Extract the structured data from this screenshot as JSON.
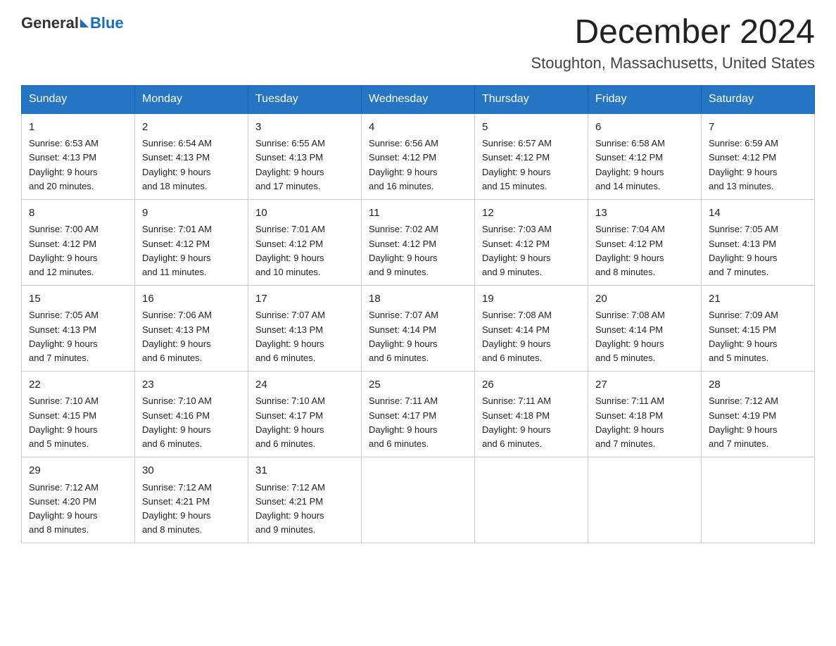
{
  "header": {
    "logo_general": "General",
    "logo_blue": "Blue",
    "month_title": "December 2024",
    "location": "Stoughton, Massachusetts, United States"
  },
  "days_header": [
    "Sunday",
    "Monday",
    "Tuesday",
    "Wednesday",
    "Thursday",
    "Friday",
    "Saturday"
  ],
  "weeks": [
    [
      {
        "day": "1",
        "sunrise": "6:53 AM",
        "sunset": "4:13 PM",
        "daylight": "9 hours and 20 minutes."
      },
      {
        "day": "2",
        "sunrise": "6:54 AM",
        "sunset": "4:13 PM",
        "daylight": "9 hours and 18 minutes."
      },
      {
        "day": "3",
        "sunrise": "6:55 AM",
        "sunset": "4:13 PM",
        "daylight": "9 hours and 17 minutes."
      },
      {
        "day": "4",
        "sunrise": "6:56 AM",
        "sunset": "4:12 PM",
        "daylight": "9 hours and 16 minutes."
      },
      {
        "day": "5",
        "sunrise": "6:57 AM",
        "sunset": "4:12 PM",
        "daylight": "9 hours and 15 minutes."
      },
      {
        "day": "6",
        "sunrise": "6:58 AM",
        "sunset": "4:12 PM",
        "daylight": "9 hours and 14 minutes."
      },
      {
        "day": "7",
        "sunrise": "6:59 AM",
        "sunset": "4:12 PM",
        "daylight": "9 hours and 13 minutes."
      }
    ],
    [
      {
        "day": "8",
        "sunrise": "7:00 AM",
        "sunset": "4:12 PM",
        "daylight": "9 hours and 12 minutes."
      },
      {
        "day": "9",
        "sunrise": "7:01 AM",
        "sunset": "4:12 PM",
        "daylight": "9 hours and 11 minutes."
      },
      {
        "day": "10",
        "sunrise": "7:01 AM",
        "sunset": "4:12 PM",
        "daylight": "9 hours and 10 minutes."
      },
      {
        "day": "11",
        "sunrise": "7:02 AM",
        "sunset": "4:12 PM",
        "daylight": "9 hours and 9 minutes."
      },
      {
        "day": "12",
        "sunrise": "7:03 AM",
        "sunset": "4:12 PM",
        "daylight": "9 hours and 9 minutes."
      },
      {
        "day": "13",
        "sunrise": "7:04 AM",
        "sunset": "4:12 PM",
        "daylight": "9 hours and 8 minutes."
      },
      {
        "day": "14",
        "sunrise": "7:05 AM",
        "sunset": "4:13 PM",
        "daylight": "9 hours and 7 minutes."
      }
    ],
    [
      {
        "day": "15",
        "sunrise": "7:05 AM",
        "sunset": "4:13 PM",
        "daylight": "9 hours and 7 minutes."
      },
      {
        "day": "16",
        "sunrise": "7:06 AM",
        "sunset": "4:13 PM",
        "daylight": "9 hours and 6 minutes."
      },
      {
        "day": "17",
        "sunrise": "7:07 AM",
        "sunset": "4:13 PM",
        "daylight": "9 hours and 6 minutes."
      },
      {
        "day": "18",
        "sunrise": "7:07 AM",
        "sunset": "4:14 PM",
        "daylight": "9 hours and 6 minutes."
      },
      {
        "day": "19",
        "sunrise": "7:08 AM",
        "sunset": "4:14 PM",
        "daylight": "9 hours and 6 minutes."
      },
      {
        "day": "20",
        "sunrise": "7:08 AM",
        "sunset": "4:14 PM",
        "daylight": "9 hours and 5 minutes."
      },
      {
        "day": "21",
        "sunrise": "7:09 AM",
        "sunset": "4:15 PM",
        "daylight": "9 hours and 5 minutes."
      }
    ],
    [
      {
        "day": "22",
        "sunrise": "7:10 AM",
        "sunset": "4:15 PM",
        "daylight": "9 hours and 5 minutes."
      },
      {
        "day": "23",
        "sunrise": "7:10 AM",
        "sunset": "4:16 PM",
        "daylight": "9 hours and 6 minutes."
      },
      {
        "day": "24",
        "sunrise": "7:10 AM",
        "sunset": "4:17 PM",
        "daylight": "9 hours and 6 minutes."
      },
      {
        "day": "25",
        "sunrise": "7:11 AM",
        "sunset": "4:17 PM",
        "daylight": "9 hours and 6 minutes."
      },
      {
        "day": "26",
        "sunrise": "7:11 AM",
        "sunset": "4:18 PM",
        "daylight": "9 hours and 6 minutes."
      },
      {
        "day": "27",
        "sunrise": "7:11 AM",
        "sunset": "4:18 PM",
        "daylight": "9 hours and 7 minutes."
      },
      {
        "day": "28",
        "sunrise": "7:12 AM",
        "sunset": "4:19 PM",
        "daylight": "9 hours and 7 minutes."
      }
    ],
    [
      {
        "day": "29",
        "sunrise": "7:12 AM",
        "sunset": "4:20 PM",
        "daylight": "9 hours and 8 minutes."
      },
      {
        "day": "30",
        "sunrise": "7:12 AM",
        "sunset": "4:21 PM",
        "daylight": "9 hours and 8 minutes."
      },
      {
        "day": "31",
        "sunrise": "7:12 AM",
        "sunset": "4:21 PM",
        "daylight": "9 hours and 9 minutes."
      },
      null,
      null,
      null,
      null
    ]
  ],
  "labels": {
    "sunrise": "Sunrise: ",
    "sunset": "Sunset: ",
    "daylight": "Daylight: "
  }
}
